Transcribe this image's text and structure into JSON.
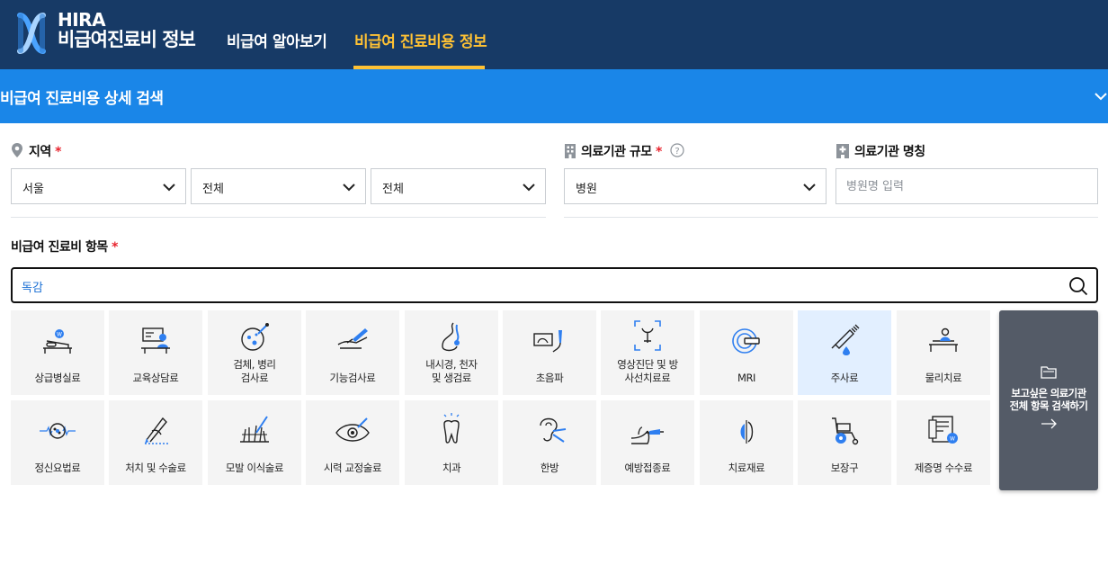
{
  "header": {
    "brand_line1": "HIRA",
    "brand_line2": "비급여진료비 정보",
    "nav": [
      "비급여 알아보기",
      "비급여 진료비용 정보"
    ],
    "active_nav_color": "#ffc234",
    "bg_color": "#173a66"
  },
  "banner": {
    "title": "비급여 진료비용 상세 검색",
    "bg_color": "#1a86e8"
  },
  "filters": {
    "region_label": "지역",
    "region_selects": [
      "서울",
      "전체",
      "전체"
    ],
    "scale_label": "의료기관 규모",
    "scale_select": "병원",
    "name_label": "의료기관 명칭",
    "name_placeholder": "병원명 입력",
    "required_mark": "*"
  },
  "item_search": {
    "label": "비급여 진료비 항목",
    "value": "독감"
  },
  "categories": [
    {
      "label": "상급병실료",
      "icon": "hospital-bed-icon"
    },
    {
      "label": "교육상담료",
      "icon": "counseling-icon"
    },
    {
      "label": "검체, 병리 검사료",
      "icon": "specimen-icon"
    },
    {
      "label": "기능검사료",
      "icon": "function-test-icon"
    },
    {
      "label": "내시경, 천자 및 생검료",
      "icon": "endoscope-icon"
    },
    {
      "label": "초음파",
      "icon": "ultrasound-icon"
    },
    {
      "label": "영상진단 및 방사선치료료",
      "icon": "xray-icon"
    },
    {
      "label": "MRI",
      "icon": "mri-icon"
    },
    {
      "label": "주사료",
      "icon": "syringe-icon"
    },
    {
      "label": "물리치료",
      "icon": "physio-icon"
    },
    {
      "label": "정신요법료",
      "icon": "brain-icon"
    },
    {
      "label": "처치 및 수술료",
      "icon": "surgery-icon"
    },
    {
      "label": "모발 이식술료",
      "icon": "hair-icon"
    },
    {
      "label": "시력 교정술료",
      "icon": "eye-icon"
    },
    {
      "label": "치과",
      "icon": "tooth-icon"
    },
    {
      "label": "한방",
      "icon": "acupuncture-icon"
    },
    {
      "label": "예방접종료",
      "icon": "vaccine-icon"
    },
    {
      "label": "치료재료",
      "icon": "material-icon"
    },
    {
      "label": "보장구",
      "icon": "wheelchair-icon"
    },
    {
      "label": "제증명 수수료",
      "icon": "certificate-icon"
    }
  ],
  "active_category": "주사료",
  "all_items_button": {
    "line1": "보고싶은 의료기관",
    "line2": "전체 항목 검색하기"
  }
}
